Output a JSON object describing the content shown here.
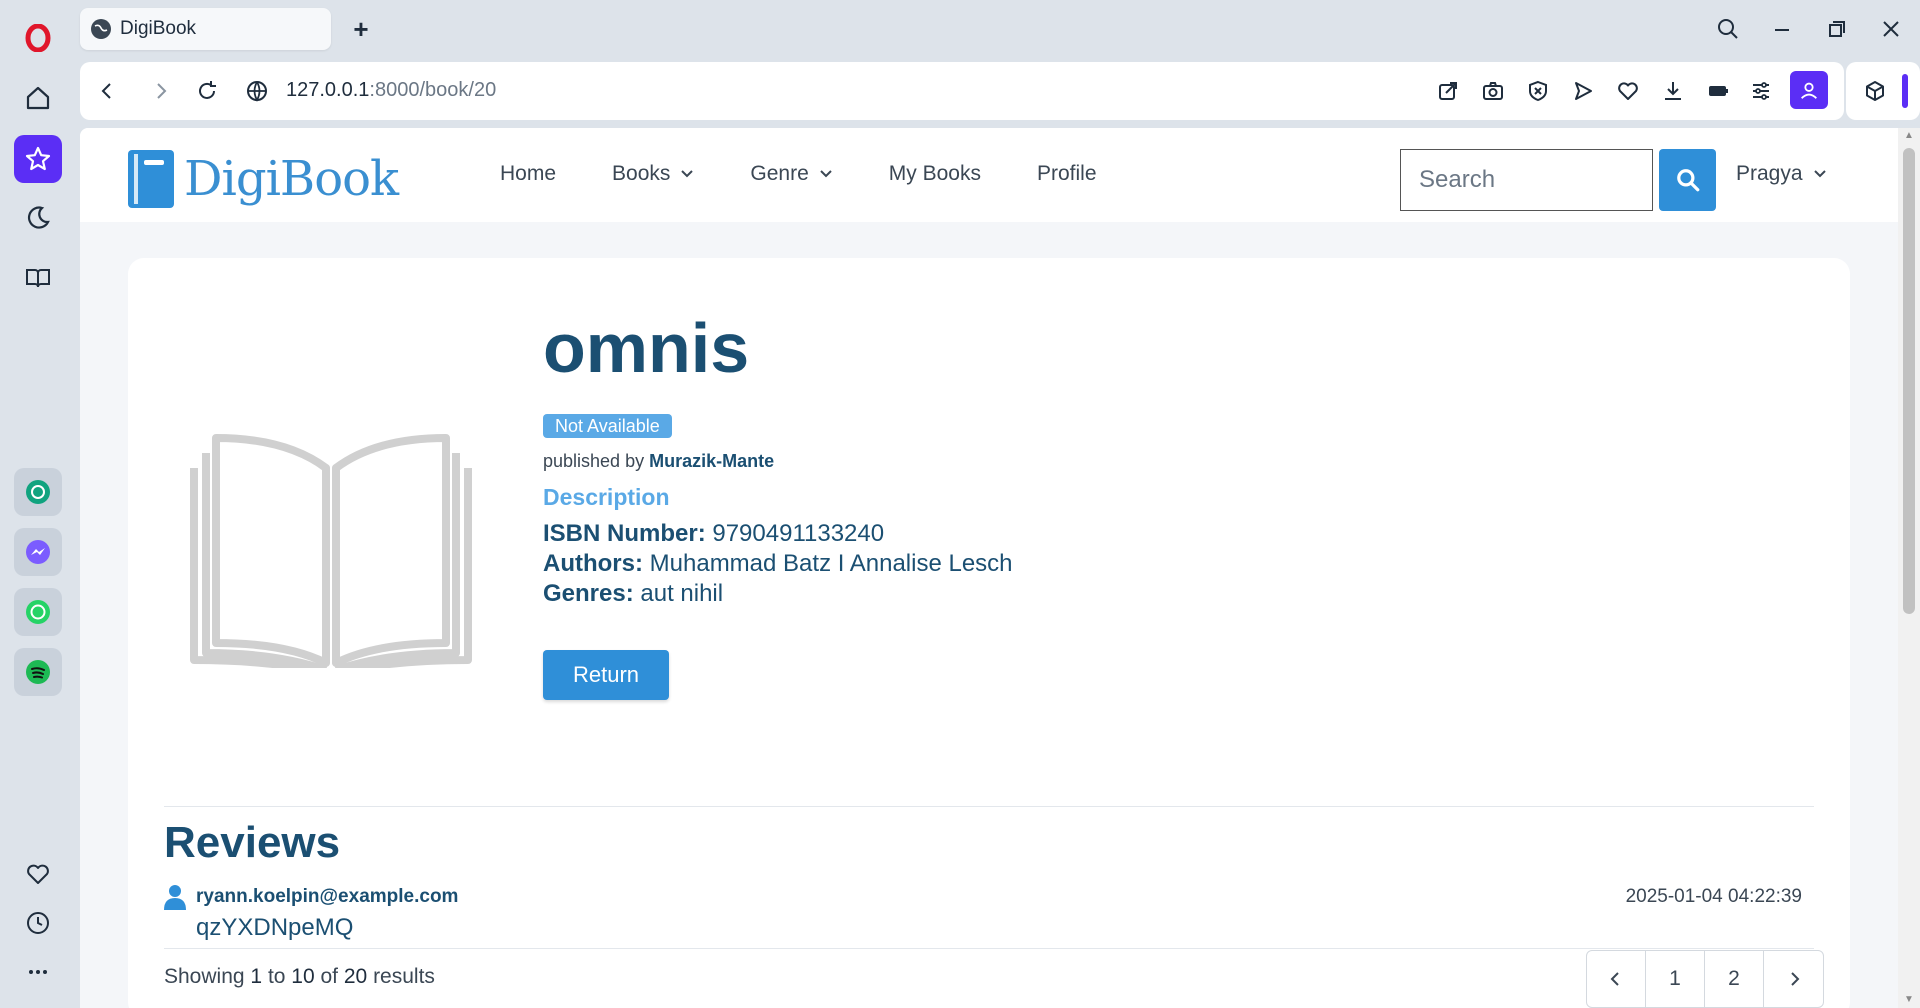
{
  "browser": {
    "tab_title": "DigiBook",
    "new_tab": "+",
    "url_host": "127.0.0.1",
    "url_rest": ":8000/book/20"
  },
  "site": {
    "logo_text": "DigiBook",
    "menu": [
      {
        "label": "Home"
      },
      {
        "label": "Books"
      },
      {
        "label": "Genre"
      },
      {
        "label": "My Books"
      },
      {
        "label": "Profile"
      }
    ],
    "search_placeholder": "Search",
    "user_name": "Pragya"
  },
  "book": {
    "title": "omnis",
    "status": "Not Available",
    "published_prefix": "published by",
    "publisher": "Murazik-Mante",
    "description_link": "Description",
    "isbn_label": "ISBN Number:",
    "isbn": "9790491133240",
    "authors_label": "Authors:",
    "authors": "Muhammad Batz I Annalise Lesch",
    "genres_label": "Genres:",
    "genres": "aut nihil",
    "return_label": "Return"
  },
  "reviews": {
    "heading": "Reviews",
    "items": [
      {
        "email": "ryann.koelpin@example.com",
        "date": "2025-01-04 04:22:39",
        "text": "qzYXDNpeMQ"
      }
    ],
    "results_prefix": "Showing",
    "from": "1",
    "to_word": "to",
    "to": "10",
    "of_word": "of",
    "total": "20",
    "results_suffix": "results",
    "pages": [
      "1",
      "2"
    ]
  },
  "colors": {
    "brand": "#2f8fd8",
    "heading": "#1b4f72",
    "badge": "#5aa9e6",
    "opera_accent": "#5b2ef5"
  }
}
